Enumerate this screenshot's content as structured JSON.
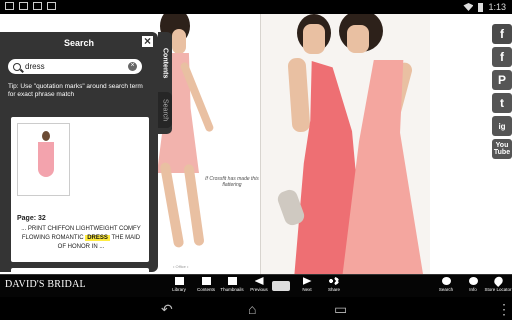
{
  "status": {
    "time": "1:13"
  },
  "panel": {
    "title": "Search",
    "close_icon": "×",
    "search_value": "dress",
    "search_placeholder": "",
    "clear_icon": "×",
    "tip": "Tip: Use \"quotation marks\" around search term for exact phrase match",
    "result": {
      "page": "Page: 32",
      "snippet_prefix": "... PRINT CHIFFON LIGHTWEIGHT COMFY FLOWING ROMANTIC",
      "snippet_match": "DRESS",
      "snippet_suffix": "THE MAID OF HONOR IN ..."
    },
    "tabs": {
      "contents": "Contents",
      "search": "Search"
    }
  },
  "page_caption": "If Crossfit has made this flattering",
  "toolbar": {
    "brand": "DAVID'S BRIDAL",
    "library": "Library",
    "contents": "Contents",
    "thumbnails": "Thumbnails",
    "previous": "Previous",
    "next": "Next",
    "share": "Share",
    "search": "Search",
    "info": "Info",
    "store_locator": "Store Locator"
  },
  "social": [
    "f",
    "f",
    "P",
    "t",
    "ig",
    "You Tube"
  ],
  "colors": {
    "coral": "#ef6f75",
    "pink": "#f2a5a1",
    "highlight": "#ffec40"
  },
  "icons": {
    "search": "magnifier",
    "close": "close",
    "clear": "clear",
    "share": "share",
    "info": "info",
    "location": "pin"
  }
}
